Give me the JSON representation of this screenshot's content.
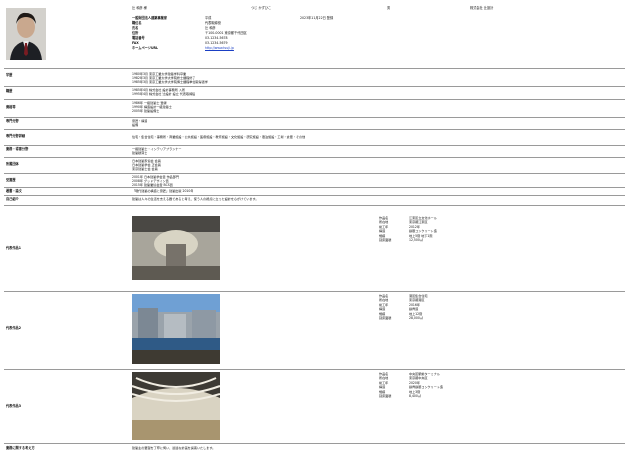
{
  "header": {
    "name_kanji": "辻 和彦 様",
    "name_kana": "つじ かずひこ",
    "gender_label": "男",
    "office_col": "株式会社 辻設計",
    "company": "一般財団法人建築事業家",
    "position_label": "職位名",
    "position_value": "代表取締役",
    "date_label": "平成",
    "date_value": "2023年11月22日 登録",
    "name_label": "氏名",
    "name_value": "辻 和彦",
    "address_label": "住所",
    "address_value": "〒100-0001 東京都千代田区",
    "tel_label": "電話番号",
    "tel_value": "03-1234-5678",
    "fax_label": "FAX",
    "fax_value": "03-1234-5679",
    "url_label": "ホームページURL",
    "url_value": "http://www.tsuji.jp"
  },
  "sections": [
    {
      "label": "学歴",
      "lines": [
        "1980年3月 東京工業大学建築学科卒業",
        "1982年3月 東京工業大学大学院修士課程修了",
        "1985年3月 東京工業大学大学院博士課程単位取得退学"
      ]
    },
    {
      "label": "職歴",
      "lines": [
        "1985年4月 株式会社 設計事務所 入所",
        "1995年4月 株式会社 辻設計 設立 代表取締役"
      ]
    },
    {
      "label": "資格等",
      "lines": [
        "1986年 一級建築士 登録",
        "1990年 構造設計一級建築士",
        "2005年 建築設備士"
      ]
    },
    {
      "label": "専門分野",
      "lines": [
        "意匠・構造",
        "設備"
      ]
    },
    {
      "label": "専門分野詳細",
      "lines": [
        "住宅・集合住宅・事務所・商業施設・公共施設・医療施設・教育施設・文化施設・研究施設・宿泊施設・工場・倉庫・その他"
      ]
    },
    {
      "label": "業務・得意分野",
      "lines": [
        "一級建築士・インテリアプランナー",
        "建築積算士"
      ]
    },
    {
      "label": "所属団体",
      "lines": [
        "日本建築家協会 会員",
        "日本建築学会 正会員",
        "東京建築士会 会員"
      ]
    },
    {
      "label": "受賞歴",
      "lines": [
        "2001年 日本建築学会賞 作品部門",
        "2008年 グッドデザイン賞",
        "2015年 建築業協会賞 BCS賞"
      ]
    },
    {
      "label": "著書・論文",
      "lines": [
        "「現代建築の構造と意匠」建築出版 2010年"
      ]
    },
    {
      "label": "自己紹介",
      "lines": [
        "建築は人々の生活を支える器であると考え、使う人の視点に立った設計を心がけています。"
      ]
    }
  ],
  "works": [
    {
      "label": "代表作品1",
      "fields": [
        {
          "k": "作品名",
          "v": "江東区立文化ホール"
        },
        {
          "k": "所在地",
          "v": "東京都江東区"
        },
        {
          "k": "竣工年",
          "v": "2012年"
        },
        {
          "k": "構造",
          "v": "鉄筋コンクリート造"
        },
        {
          "k": "規模",
          "v": "地上5階 地下1階"
        },
        {
          "k": "延床面積",
          "v": "12,500㎡"
        }
      ]
    },
    {
      "label": "代表作品2",
      "fields": [
        {
          "k": "作品名",
          "v": "港区集合住宅"
        },
        {
          "k": "所在地",
          "v": "東京都港区"
        },
        {
          "k": "竣工年",
          "v": "2016年"
        },
        {
          "k": "構造",
          "v": "鉄骨造"
        },
        {
          "k": "規模",
          "v": "地上12階"
        },
        {
          "k": "延床面積",
          "v": "28,000㎡"
        }
      ]
    },
    {
      "label": "代表作品3",
      "fields": [
        {
          "k": "作品名",
          "v": "中央区駅前ターミナル"
        },
        {
          "k": "所在地",
          "v": "東京都中央区"
        },
        {
          "k": "竣工年",
          "v": "2020年"
        },
        {
          "k": "構造",
          "v": "鉄骨鉄筋コンクリート造"
        },
        {
          "k": "規模",
          "v": "地上3階"
        },
        {
          "k": "延床面積",
          "v": "8,400㎡"
        }
      ]
    }
  ],
  "footer": {
    "label": "業務に関する考え方",
    "text": "建築主の要望を丁寧に伺い、最適な計画を提案いたします。"
  }
}
